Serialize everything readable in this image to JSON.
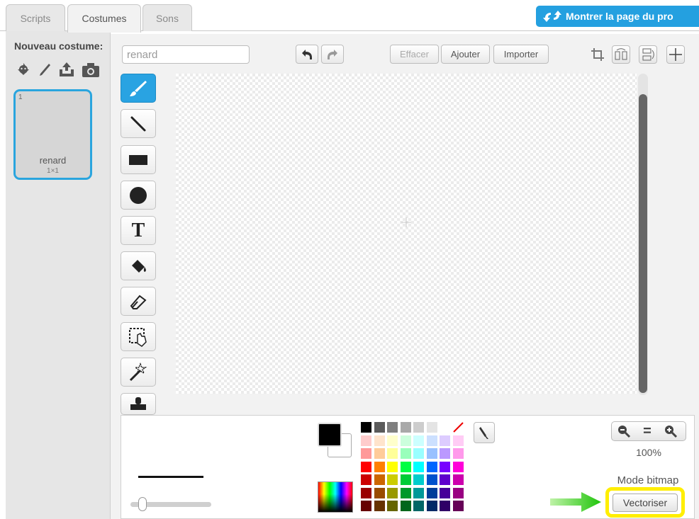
{
  "tabs": [
    {
      "label": "Scripts"
    },
    {
      "label": "Costumes"
    },
    {
      "label": "Sons"
    }
  ],
  "share_button": {
    "label": "Montrer la page du pro"
  },
  "sprite_panel": {
    "new_costume_label": "Nouveau costume:",
    "costume_icons": [
      "sprite-library-icon",
      "paint-brush-icon",
      "upload-icon",
      "camera-icon"
    ],
    "costumes": [
      {
        "index": "1",
        "name": "renard",
        "size": "1×1"
      }
    ]
  },
  "editor": {
    "name_input_value": "renard",
    "buttons": {
      "clear": "Effacer",
      "add": "Ajouter",
      "import": "Importer"
    },
    "tools": [
      "brush-icon",
      "line-icon",
      "rectangle-icon",
      "ellipse-icon",
      "text-icon",
      "fill-icon",
      "eraser-icon",
      "select-icon",
      "magic-wand-icon",
      "stamp-icon"
    ],
    "text_tool_glyph": "T",
    "zoom_level": "100%",
    "mode_label": "Mode bitmap",
    "vectorize_button": "Vectoriser",
    "zoom_reset_glyph": "="
  },
  "colors": {
    "accent": "#29a3e2",
    "highlight": "#ffee00",
    "arrow": "#2ecc1a",
    "primary": "#000000",
    "secondary": "#ffffff"
  },
  "palette": [
    [
      "#000000",
      "#5b5b5b",
      "#7f7f7f",
      "#a9a9a9",
      "#cdcdcd",
      "#e4e4e4",
      "#ffffff",
      "none"
    ],
    [
      "#ffcccc",
      "#ffe4cc",
      "#ffffcc",
      "#ccffdd",
      "#ccffff",
      "#cce0ff",
      "#ddccff",
      "#ffccf5"
    ],
    [
      "#ff9999",
      "#ffcc99",
      "#ffff99",
      "#99ffbb",
      "#99ffff",
      "#99c1ff",
      "#bb99ff",
      "#ff99eb"
    ],
    [
      "#ff0000",
      "#ff8000",
      "#ffff00",
      "#00ff44",
      "#00ffff",
      "#0066ff",
      "#7700ff",
      "#ff00d9"
    ],
    [
      "#cc0000",
      "#cc6600",
      "#cccc00",
      "#00cc36",
      "#00cccc",
      "#0051cc",
      "#5f00cc",
      "#cc00ad"
    ],
    [
      "#990000",
      "#994c00",
      "#999900",
      "#009929",
      "#009999",
      "#003d99",
      "#470099",
      "#990082"
    ],
    [
      "#660000",
      "#663300",
      "#666600",
      "#00661b",
      "#006666",
      "#002966",
      "#2f0066",
      "#660057"
    ]
  ]
}
